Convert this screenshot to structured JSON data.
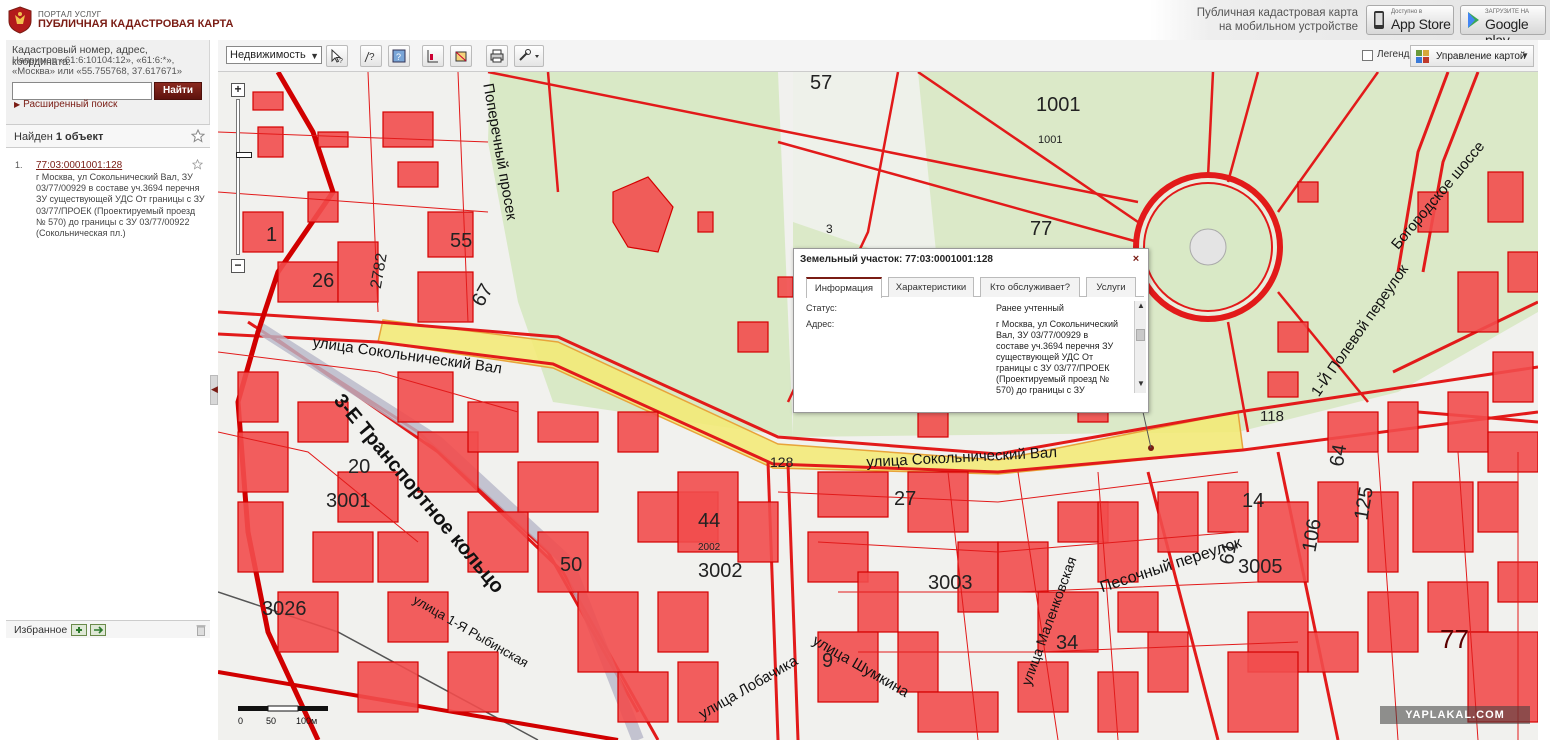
{
  "header": {
    "portal_small": "ПОРТАЛ УСЛУГ",
    "portal_title": "ПУБЛИЧНАЯ КАДАСТРОВАЯ КАРТА",
    "mobile_line1": "Публичная кадастровая карта",
    "mobile_line2": "на мобильном устройстве",
    "appstore_small": "Доступно в",
    "appstore_big": "App Store",
    "googleplay_small": "ЗАГРУЗИТЕ НА",
    "googleplay_big": "Google play"
  },
  "search": {
    "label": "Кадастровый номер, адрес, координата:",
    "hint": "Например «61:6:10104:12», «61:6:*», «Москва» или «55.755768, 37.617671»",
    "input_value": "",
    "button": "Найти",
    "advanced": "Расширенный поиск"
  },
  "results": {
    "found_prefix": "Найден ",
    "found_count": "1 объект",
    "items": [
      {
        "num": "1.",
        "cadastral": "77:03:0001001:128",
        "description": "г Москва, ул Сокольнический Вал, ЗУ 03/77/00929 в составе уч.3694 перечня ЗУ существующей УДС От границы с ЗУ 03/77/ПРОЕК (Проектируемый проезд № 570) до границы с ЗУ 03/77/00922 (Сокольническая пл.)"
      }
    ]
  },
  "favorites": {
    "label": "Избранное"
  },
  "toolbar": {
    "layer": "Недвижимость",
    "legend": "Легенда",
    "map_manage": "Управление картой"
  },
  "popup": {
    "title": "Земельный участок: 77:03:0001001:128",
    "tabs": [
      "Информация",
      "Характеристики",
      "Кто обслуживает?",
      "Услуги"
    ],
    "status_key": "Статус:",
    "status_value": "Ранее учтенный",
    "address_key": "Адрес:",
    "address_value": "г Москва, ул Сокольнический Вал, ЗУ 03/77/00929 в составе уч.3694 перечня ЗУ существующей УДС От границы с ЗУ 03/77/ПРОЕК (Проектируемый проезд № 570) до границы с ЗУ"
  },
  "map": {
    "streets": {
      "sokol_val_1": "улица Сокольнический Вал",
      "sokol_val_2": "улица Сокольнический Вал",
      "ttk": "3-Е Транспортное кольцо",
      "poperechny": "Поперечный просек",
      "pesochny": "Песочный переулок",
      "lobachika": "улица Лобачика",
      "shumkina": "улица Шумкина",
      "rybinskaya": "улица 1-Я Рыбинская",
      "polevoy": "1-Й Полевой переулок",
      "bogorodskoe": "Богородское шоссе",
      "malenkovskaya": "улица Маленковская"
    },
    "block_numbers": [
      "1001",
      "3001",
      "3002",
      "3003",
      "3005",
      "3026",
      "77",
      "77",
      "1001",
      "2002",
      "57",
      "3"
    ],
    "labels": [
      "128",
      "118",
      "44",
      "27",
      "14",
      "50",
      "9",
      "55",
      "67",
      "26",
      "2782",
      "125",
      "106",
      "61",
      "64",
      "34",
      "20",
      "1"
    ],
    "scale_labels": [
      "0",
      "50",
      "100м"
    ],
    "watermark": "YAPLAKAL.COM"
  },
  "colors": {
    "brand": "#7a1c14",
    "parcel_fill": "#f04848",
    "parcel_stroke": "#e01010",
    "park": "#d8e8c4",
    "highlight": "#f4e96a"
  }
}
